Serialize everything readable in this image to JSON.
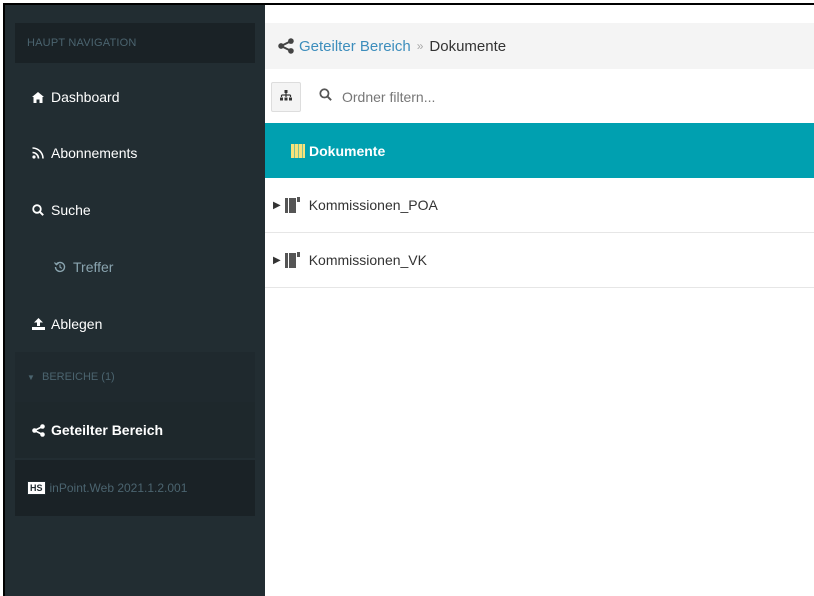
{
  "sidebar": {
    "header": "Haupt Navigation",
    "items": [
      {
        "icon": "home-icon",
        "label": "Dashboard"
      },
      {
        "icon": "rss-icon",
        "label": "Abonnements"
      },
      {
        "icon": "search-icon",
        "label": "Suche"
      },
      {
        "icon": "history-icon",
        "label": "Treffer"
      },
      {
        "icon": "upload-icon",
        "label": "Ablegen"
      }
    ],
    "section": "Bereiche (1)",
    "active_item": {
      "icon": "share-icon",
      "label": "Geteilter Bereich"
    },
    "version": {
      "logo": "HS",
      "text": "inPoint.Web 2021.1.2.001"
    }
  },
  "breadcrumb": {
    "icon": "share-icon",
    "link": "Geteilter Bereich",
    "separator": "»",
    "current": "Dokumente"
  },
  "toolbar": {
    "tree_button_icon": "sitemap-icon",
    "filter_placeholder": "Ordner filtern..."
  },
  "tree": {
    "root": {
      "icon": "library-icon",
      "label": "Dokumente"
    },
    "children": [
      {
        "icon": "binder-icon",
        "label": "Kommissionen_POA"
      },
      {
        "icon": "binder-icon",
        "label": "Kommissionen_VK"
      }
    ]
  },
  "colors": {
    "sidebar_bg": "#222d32",
    "accent": "#00a0b0",
    "link": "#3c8dbc"
  }
}
